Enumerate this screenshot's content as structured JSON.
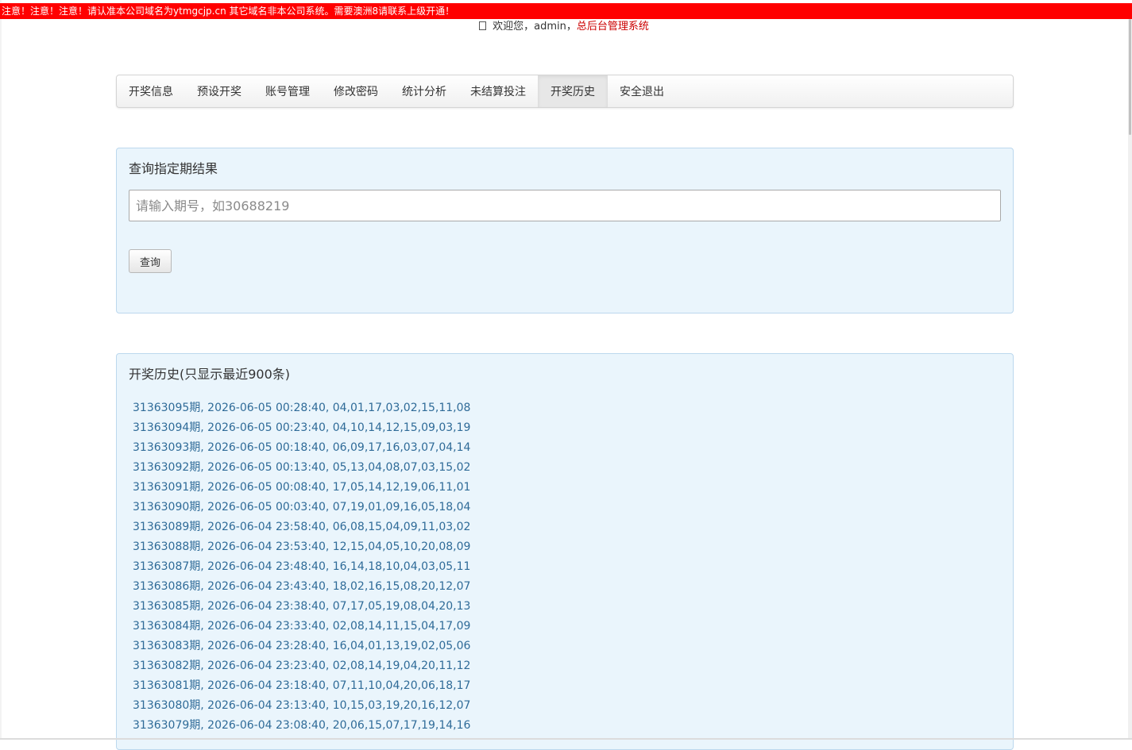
{
  "notice": {
    "text": "注意！注意！注意！请认准本公司域名为ytmgcjp.cn 其它域名非本公司系统。需要澳洲8请联系上级开通！"
  },
  "header": {
    "user_icon": "user-icon",
    "welcome_prefix": "欢迎您，admin，",
    "system_link": "总后台管理系统"
  },
  "nav": {
    "items": [
      {
        "label": "开奖信息"
      },
      {
        "label": "预设开奖"
      },
      {
        "label": "账号管理"
      },
      {
        "label": "修改密码"
      },
      {
        "label": "统计分析"
      },
      {
        "label": "未结算投注"
      },
      {
        "label": "开奖历史"
      },
      {
        "label": "安全退出"
      }
    ],
    "active": "开奖历史"
  },
  "query": {
    "title": "查询指定期结果",
    "placeholder": "请输入期号，如30688219",
    "button": "查询"
  },
  "history": {
    "title": "开奖历史(只显示最近900条)",
    "rows": [
      "31363095期, 2026-06-05 00:28:40, 04,01,17,03,02,15,11,08",
      "31363094期, 2026-06-05 00:23:40, 04,10,14,12,15,09,03,19",
      "31363093期, 2026-06-05 00:18:40, 06,09,17,16,03,07,04,14",
      "31363092期, 2026-06-05 00:13:40, 05,13,04,08,07,03,15,02",
      "31363091期, 2026-06-05 00:08:40, 17,05,14,12,19,06,11,01",
      "31363090期, 2026-06-05 00:03:40, 07,19,01,09,16,05,18,04",
      "31363089期, 2026-06-04 23:58:40, 06,08,15,04,09,11,03,02",
      "31363088期, 2026-06-04 23:53:40, 12,15,04,05,10,20,08,09",
      "31363087期, 2026-06-04 23:48:40, 16,14,18,10,04,03,05,11",
      "31363086期, 2026-06-04 23:43:40, 18,02,16,15,08,20,12,07",
      "31363085期, 2026-06-04 23:38:40, 07,17,05,19,08,04,20,13",
      "31363084期, 2026-06-04 23:33:40, 02,08,14,11,15,04,17,09",
      "31363083期, 2026-06-04 23:28:40, 16,04,01,13,19,02,05,06",
      "31363082期, 2026-06-04 23:23:40, 02,08,14,19,04,20,11,12",
      "31363081期, 2026-06-04 23:18:40, 07,11,10,04,20,06,18,17",
      "31363080期, 2026-06-04 23:13:40, 10,15,03,19,20,16,12,07",
      "31363079期, 2026-06-04 23:08:40, 20,06,15,07,17,19,14,16"
    ]
  }
}
